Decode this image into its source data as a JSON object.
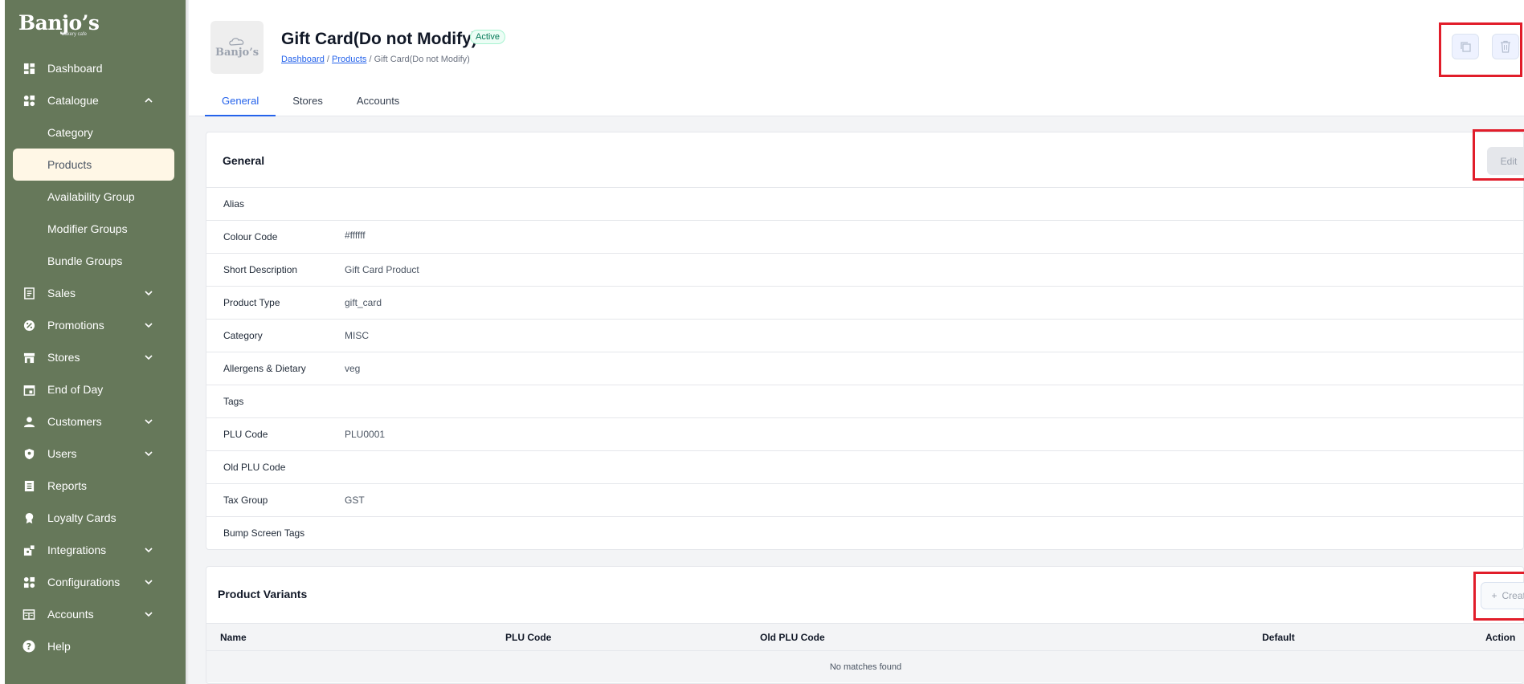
{
  "brand": {
    "logo": "Banjo’s",
    "logo_sub": "bakery cafe"
  },
  "sidebar": {
    "items": [
      {
        "label": "Dashboard",
        "icon": "dashboard-icon"
      },
      {
        "label": "Catalogue",
        "icon": "catalogue-icon",
        "expanded": true
      },
      {
        "label": "Category"
      },
      {
        "label": "Products",
        "active": true
      },
      {
        "label": "Availability Group"
      },
      {
        "label": "Modifier Groups"
      },
      {
        "label": "Bundle Groups"
      },
      {
        "label": "Sales",
        "icon": "receipt-icon"
      },
      {
        "label": "Promotions",
        "icon": "percent-badge-icon"
      },
      {
        "label": "Stores",
        "icon": "store-icon"
      },
      {
        "label": "End of Day",
        "icon": "calendar-icon"
      },
      {
        "label": "Customers",
        "icon": "person-icon"
      },
      {
        "label": "Users",
        "icon": "shield-user-icon"
      },
      {
        "label": "Reports",
        "icon": "report-icon"
      },
      {
        "label": "Loyalty Cards",
        "icon": "award-icon"
      },
      {
        "label": "Integrations",
        "icon": "integrations-icon"
      },
      {
        "label": "Configurations",
        "icon": "configurations-icon"
      },
      {
        "label": "Accounts",
        "icon": "accounts-icon"
      },
      {
        "label": "Help",
        "icon": "help-icon"
      }
    ]
  },
  "header": {
    "thumb_text": "Banjo’s",
    "title": "Gift Card(Do not Modify)",
    "status": "Active",
    "breadcrumb": {
      "dashboard": "Dashboard",
      "products": "Products",
      "sep": "/",
      "current": "Gift Card(Do not Modify)"
    }
  },
  "tabs": [
    "General",
    "Stores",
    "Accounts"
  ],
  "general": {
    "title": "General",
    "edit_label": "Edit",
    "fields": [
      {
        "label": "Alias",
        "value": ""
      },
      {
        "label": "Colour Code",
        "value": "#ffffff"
      },
      {
        "label": "Short Description",
        "value": "Gift Card Product"
      },
      {
        "label": "Product Type",
        "value": "gift_card"
      },
      {
        "label": "Category",
        "value": "MISC"
      },
      {
        "label": "Allergens & Dietary",
        "value": "veg"
      },
      {
        "label": "Tags",
        "value": ""
      },
      {
        "label": "PLU Code",
        "value": "PLU0001"
      },
      {
        "label": "Old PLU Code",
        "value": ""
      },
      {
        "label": "Tax Group",
        "value": "GST"
      },
      {
        "label": "Bump Screen Tags",
        "value": ""
      }
    ]
  },
  "variants": {
    "title": "Product Variants",
    "create_label": "Create",
    "columns": [
      "Name",
      "PLU Code",
      "Old PLU Code",
      "Default",
      "Action"
    ],
    "empty": "No matches found"
  },
  "colors": {
    "sidebar": "#66785a",
    "accent": "#2563eb",
    "highlight": "#e11d2a",
    "active_nav": "#fff7e6"
  }
}
